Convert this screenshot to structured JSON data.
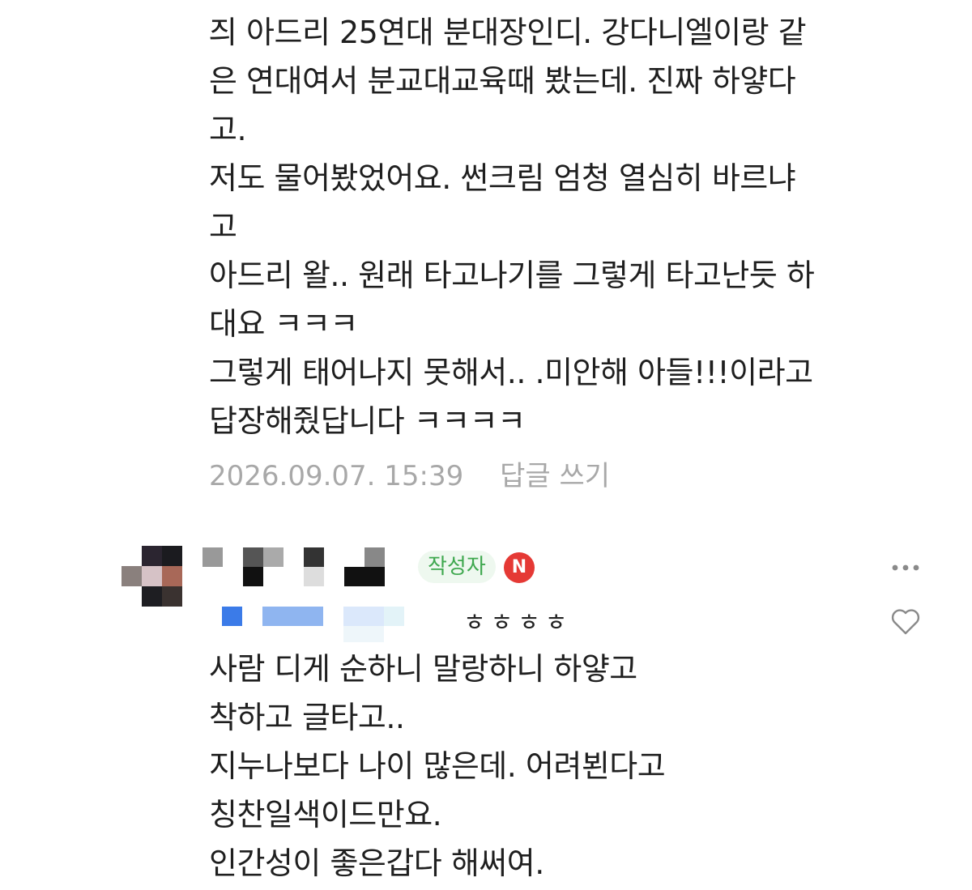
{
  "comment1": {
    "lines": [
      "즤 아드리 25연대 분대장인디. 강다니엘이랑 같",
      "은 연대여서 분교대교육때 봤는데. 진짜 하얗다",
      "고.",
      "저도 물어봤었어요. 썬크림 엄청 열심히 바르냐",
      "고",
      "아드리 왈.. 원래 타고나기를 그렇게 타고난듯 하",
      "대요 ㅋㅋㅋ",
      "그렇게 태어나지 못해서.. .미안해 아들!!!이라고",
      "답장해줬답니다 ㅋㅋㅋㅋ"
    ],
    "timestamp": "2026.09.07. 15:39",
    "reply_label": "답글 쓰기"
  },
  "comment2": {
    "author_badge": "작성자",
    "n_badge": "N",
    "mention_tail": "ㅎㅎㅎㅎ",
    "lines": [
      "사람 디게 순하니 말랑하니 하얗고",
      "착하고 글타고..",
      "지누나보다 나이 많은데. 어려뵌다고",
      "칭찬일색이드만요.",
      "인간성이 좋은갑다 해써여."
    ],
    "icons": {
      "more": "more-dots-icon",
      "like": "heart-icon"
    }
  },
  "colors": {
    "text": "#1f1f1f",
    "meta": "#a8a8a8",
    "author_badge_bg": "#eef8ef",
    "author_badge_text": "#3fa84f",
    "n_badge": "#e53935"
  }
}
